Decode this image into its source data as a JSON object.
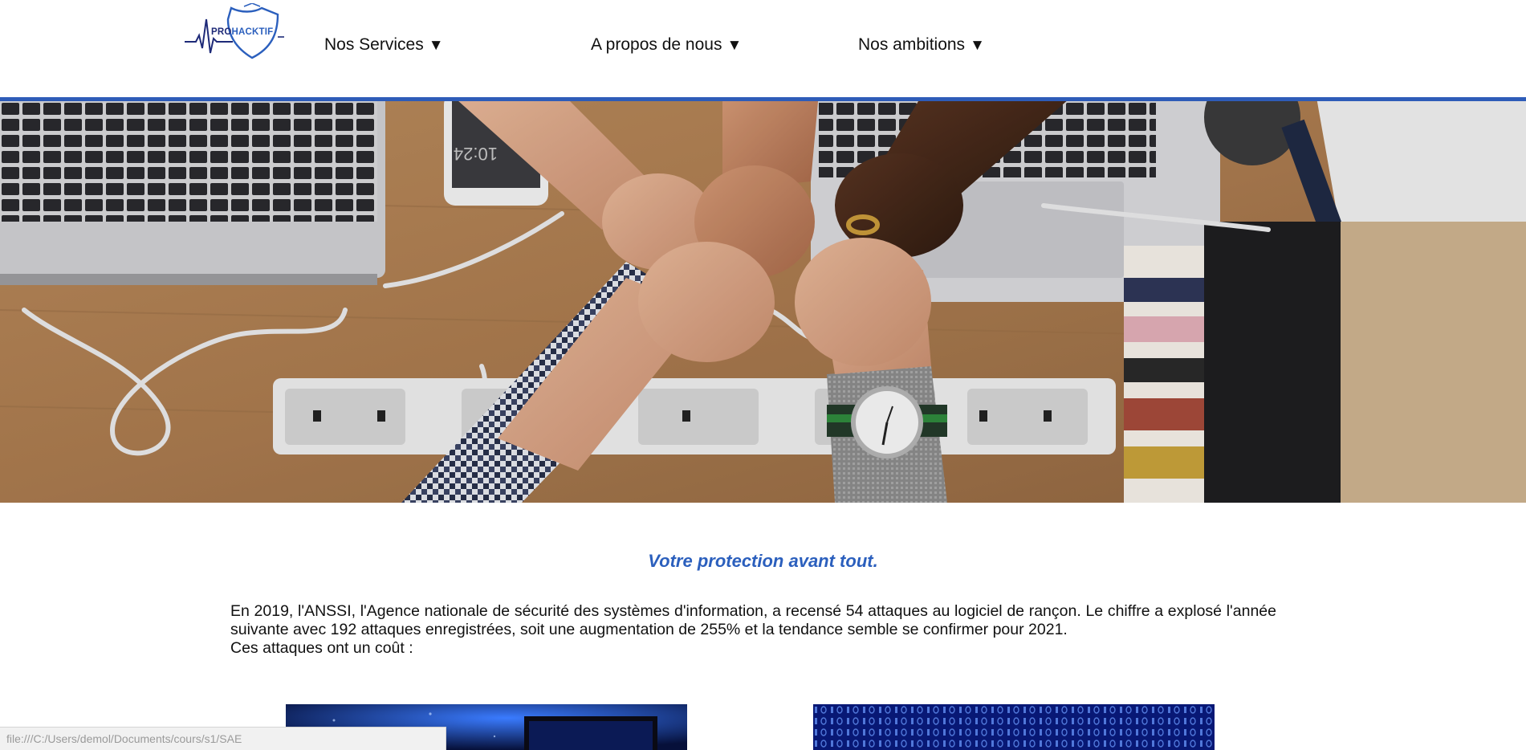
{
  "logo": {
    "text_pro": "PRO",
    "text_hacktif": "HACKTIF",
    "icon": "shield-heartbeat-logo"
  },
  "nav": {
    "items": [
      {
        "label": "Nos Services",
        "caret": "▼"
      },
      {
        "label": "A propos de nous",
        "caret": "▼"
      },
      {
        "label": "Nos ambitions",
        "caret": "▼"
      }
    ]
  },
  "hero": {
    "icon": "teamwork-fist-bump-photo"
  },
  "content": {
    "tagline": "Votre protection avant tout.",
    "paragraph": "En 2019, l'ANSSI, l'Agence nationale de sécurité des systèmes d'information, a recensé 54 attaques au logiciel de rançon. Le chiffre a explosé l'année suivante avec 192 attaques enregistrées, soit une augmentation de 255% et la tendance semble se confirmer pour 2021.",
    "paragraph_last": "Ces attaques ont un coût :"
  },
  "thumbnails": [
    {
      "icon": "cyber-globe-screen-image"
    },
    {
      "icon": "binary-code-image"
    }
  ],
  "statusbar": {
    "url": "file:///C:/Users/demol/Documents/cours/s1/SAE"
  },
  "colors": {
    "accent": "#2e5cb8",
    "tagline": "#2b5fbd",
    "logo_dark": "#1e2a78"
  }
}
